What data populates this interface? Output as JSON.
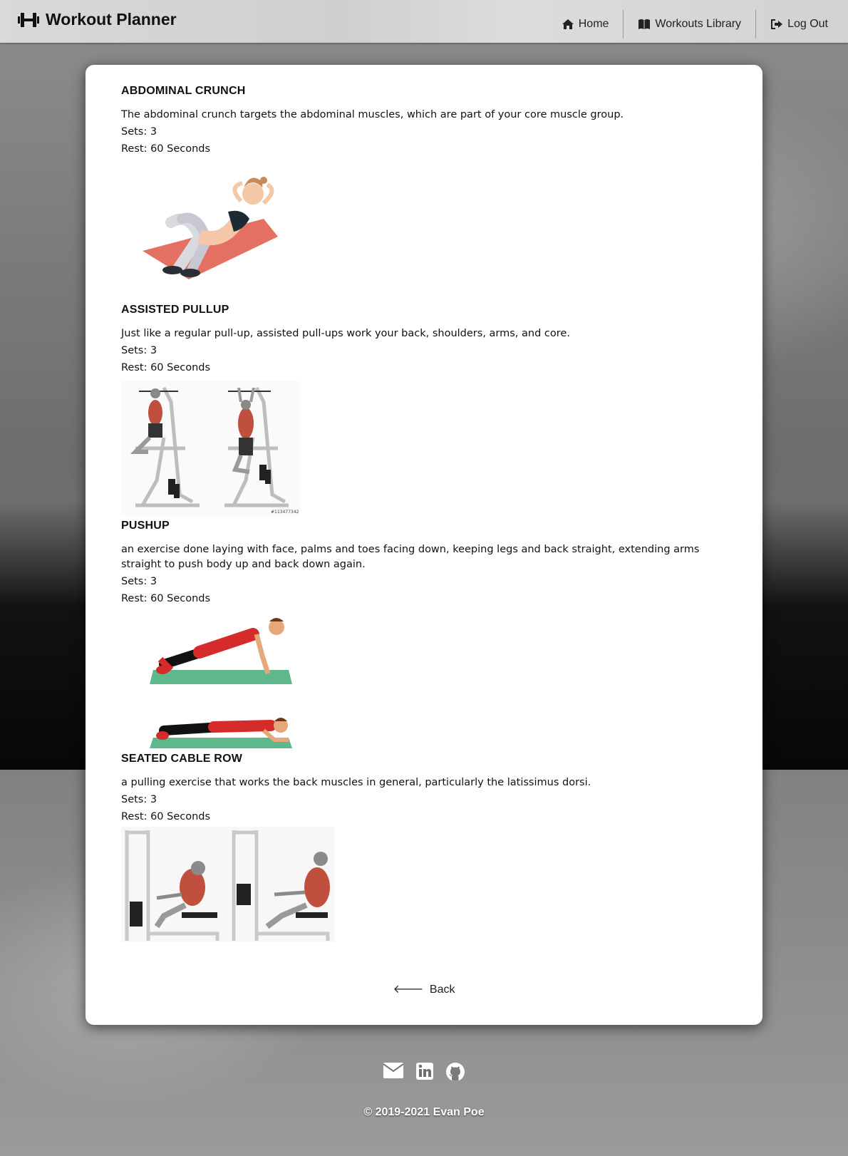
{
  "app": {
    "title": "Workout Planner"
  },
  "nav": {
    "home": "Home",
    "library": "Workouts Library",
    "logout": "Log Out"
  },
  "exercises": [
    {
      "name": "ABDOMINAL CRUNCH",
      "description": "The abdominal crunch targets the abdominal muscles, which are part of your core muscle group.",
      "sets": "Sets: 3",
      "rest": "Rest: 60 Seconds"
    },
    {
      "name": "ASSISTED PULLUP",
      "description": "Just like a regular pull-up, assisted pull-ups work your back, shoulders, arms, and core.",
      "sets": "Sets: 3",
      "rest": "Rest: 60 Seconds"
    },
    {
      "name": "PUSHUP",
      "description": "an exercise done laying with face, palms and toes facing down, keeping legs and back straight, extending arms straight to push body up and back down again.",
      "sets": "Sets: 3",
      "rest": "Rest: 60 Seconds"
    },
    {
      "name": "SEATED CABLE ROW",
      "description": "a pulling exercise that works the back muscles in general, particularly the latissimus dorsi.",
      "sets": "Sets: 3",
      "rest": "Rest: 60 Seconds"
    }
  ],
  "images": {
    "pullup_id": "#113477342"
  },
  "back": "Back",
  "footer": {
    "copyright": "© 2019-2021 Evan Poe"
  },
  "icons": [
    "dumbbell-icon",
    "home-icon",
    "book-icon",
    "logout-icon",
    "arrow-left-icon",
    "email-icon",
    "linkedin-icon",
    "github-icon"
  ]
}
